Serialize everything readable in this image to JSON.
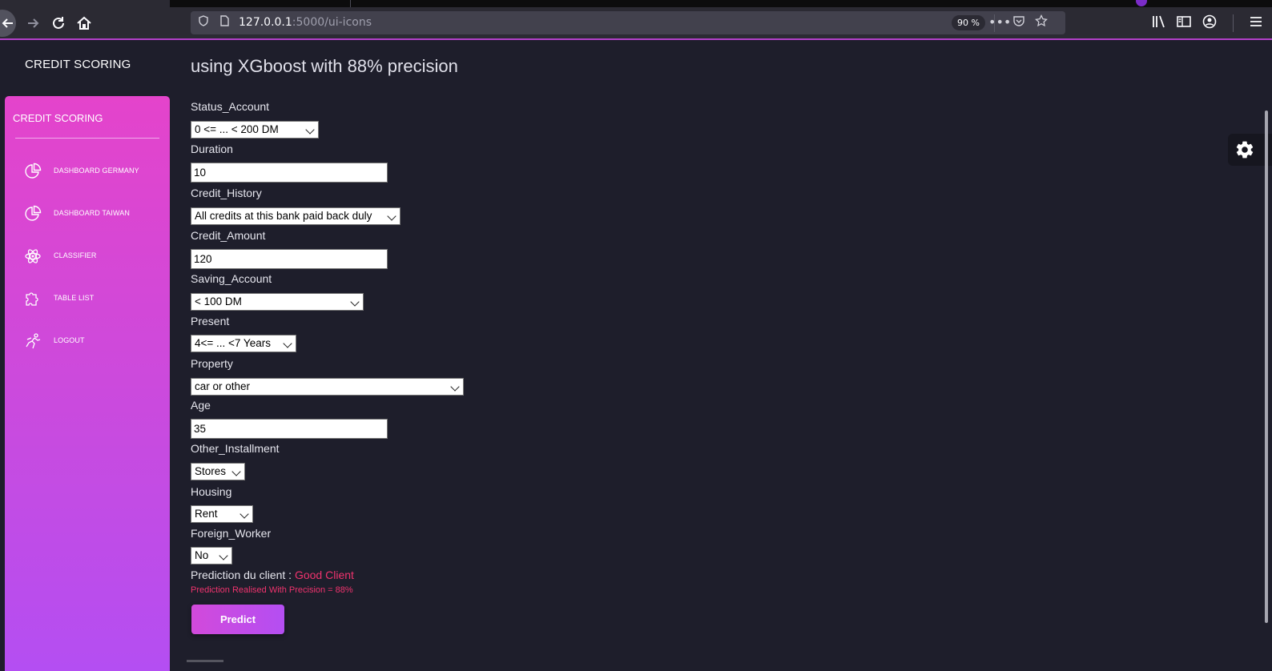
{
  "browser": {
    "url_host": "127.0.0.1",
    "url_path": ":5000/ui-icons",
    "zoom": "90 %",
    "icons": [
      "back-icon",
      "forward-icon",
      "reload-icon",
      "home-icon",
      "shield-icon",
      "page-icon",
      "more-icon",
      "pocket-icon",
      "star-icon",
      "library-icon",
      "sidebar-icon",
      "account-icon",
      "menu-icon"
    ]
  },
  "app": {
    "brand": "CREDIT SCORING",
    "title": "using XGboost with 88% precision"
  },
  "sidebar": {
    "brand": "CREDIT SCORING",
    "items": [
      {
        "label": "DASHBOARD GERMANY",
        "icon": "pie-chart-icon"
      },
      {
        "label": "DASHBOARD TAIWAN",
        "icon": "pie-chart-icon"
      },
      {
        "label": "CLASSIFIER",
        "icon": "atom-icon"
      },
      {
        "label": "TABLE LIST",
        "icon": "puzzle-icon"
      },
      {
        "label": "LOGOUT",
        "icon": "running-person-icon"
      }
    ]
  },
  "form": {
    "fields": [
      {
        "label": "Status_Account",
        "type": "select",
        "value": "0 <= ... < 200 DM"
      },
      {
        "label": "Duration",
        "type": "input",
        "value": "10"
      },
      {
        "label": "Credit_History",
        "type": "select",
        "value": "All credits at this bank paid back duly"
      },
      {
        "label": "Credit_Amount",
        "type": "input",
        "value": "120"
      },
      {
        "label": "Saving_Account",
        "type": "select",
        "value": "< 100 DM"
      },
      {
        "label": "Present",
        "type": "select",
        "value": "4<= ... <7 Years"
      },
      {
        "label": "Property",
        "type": "select",
        "value": "car or other"
      },
      {
        "label": "Age",
        "type": "input",
        "value": "35"
      },
      {
        "label": "Other_Installment",
        "type": "select",
        "value": "Stores"
      },
      {
        "label": "Housing",
        "type": "select",
        "value": "Rent"
      },
      {
        "label": "Foreign_Worker",
        "type": "select",
        "value": "No"
      }
    ],
    "prediction_label": "Prediction du client :",
    "prediction_value": "Good Client",
    "prediction_note": "Prediction Realised With Precision = 88%",
    "submit_label": "Predict"
  },
  "colors": {
    "accent": "#f0336e",
    "sidebar_top": "#e444cb",
    "sidebar_bottom": "#b44ef2",
    "background": "#1e1e2b"
  }
}
